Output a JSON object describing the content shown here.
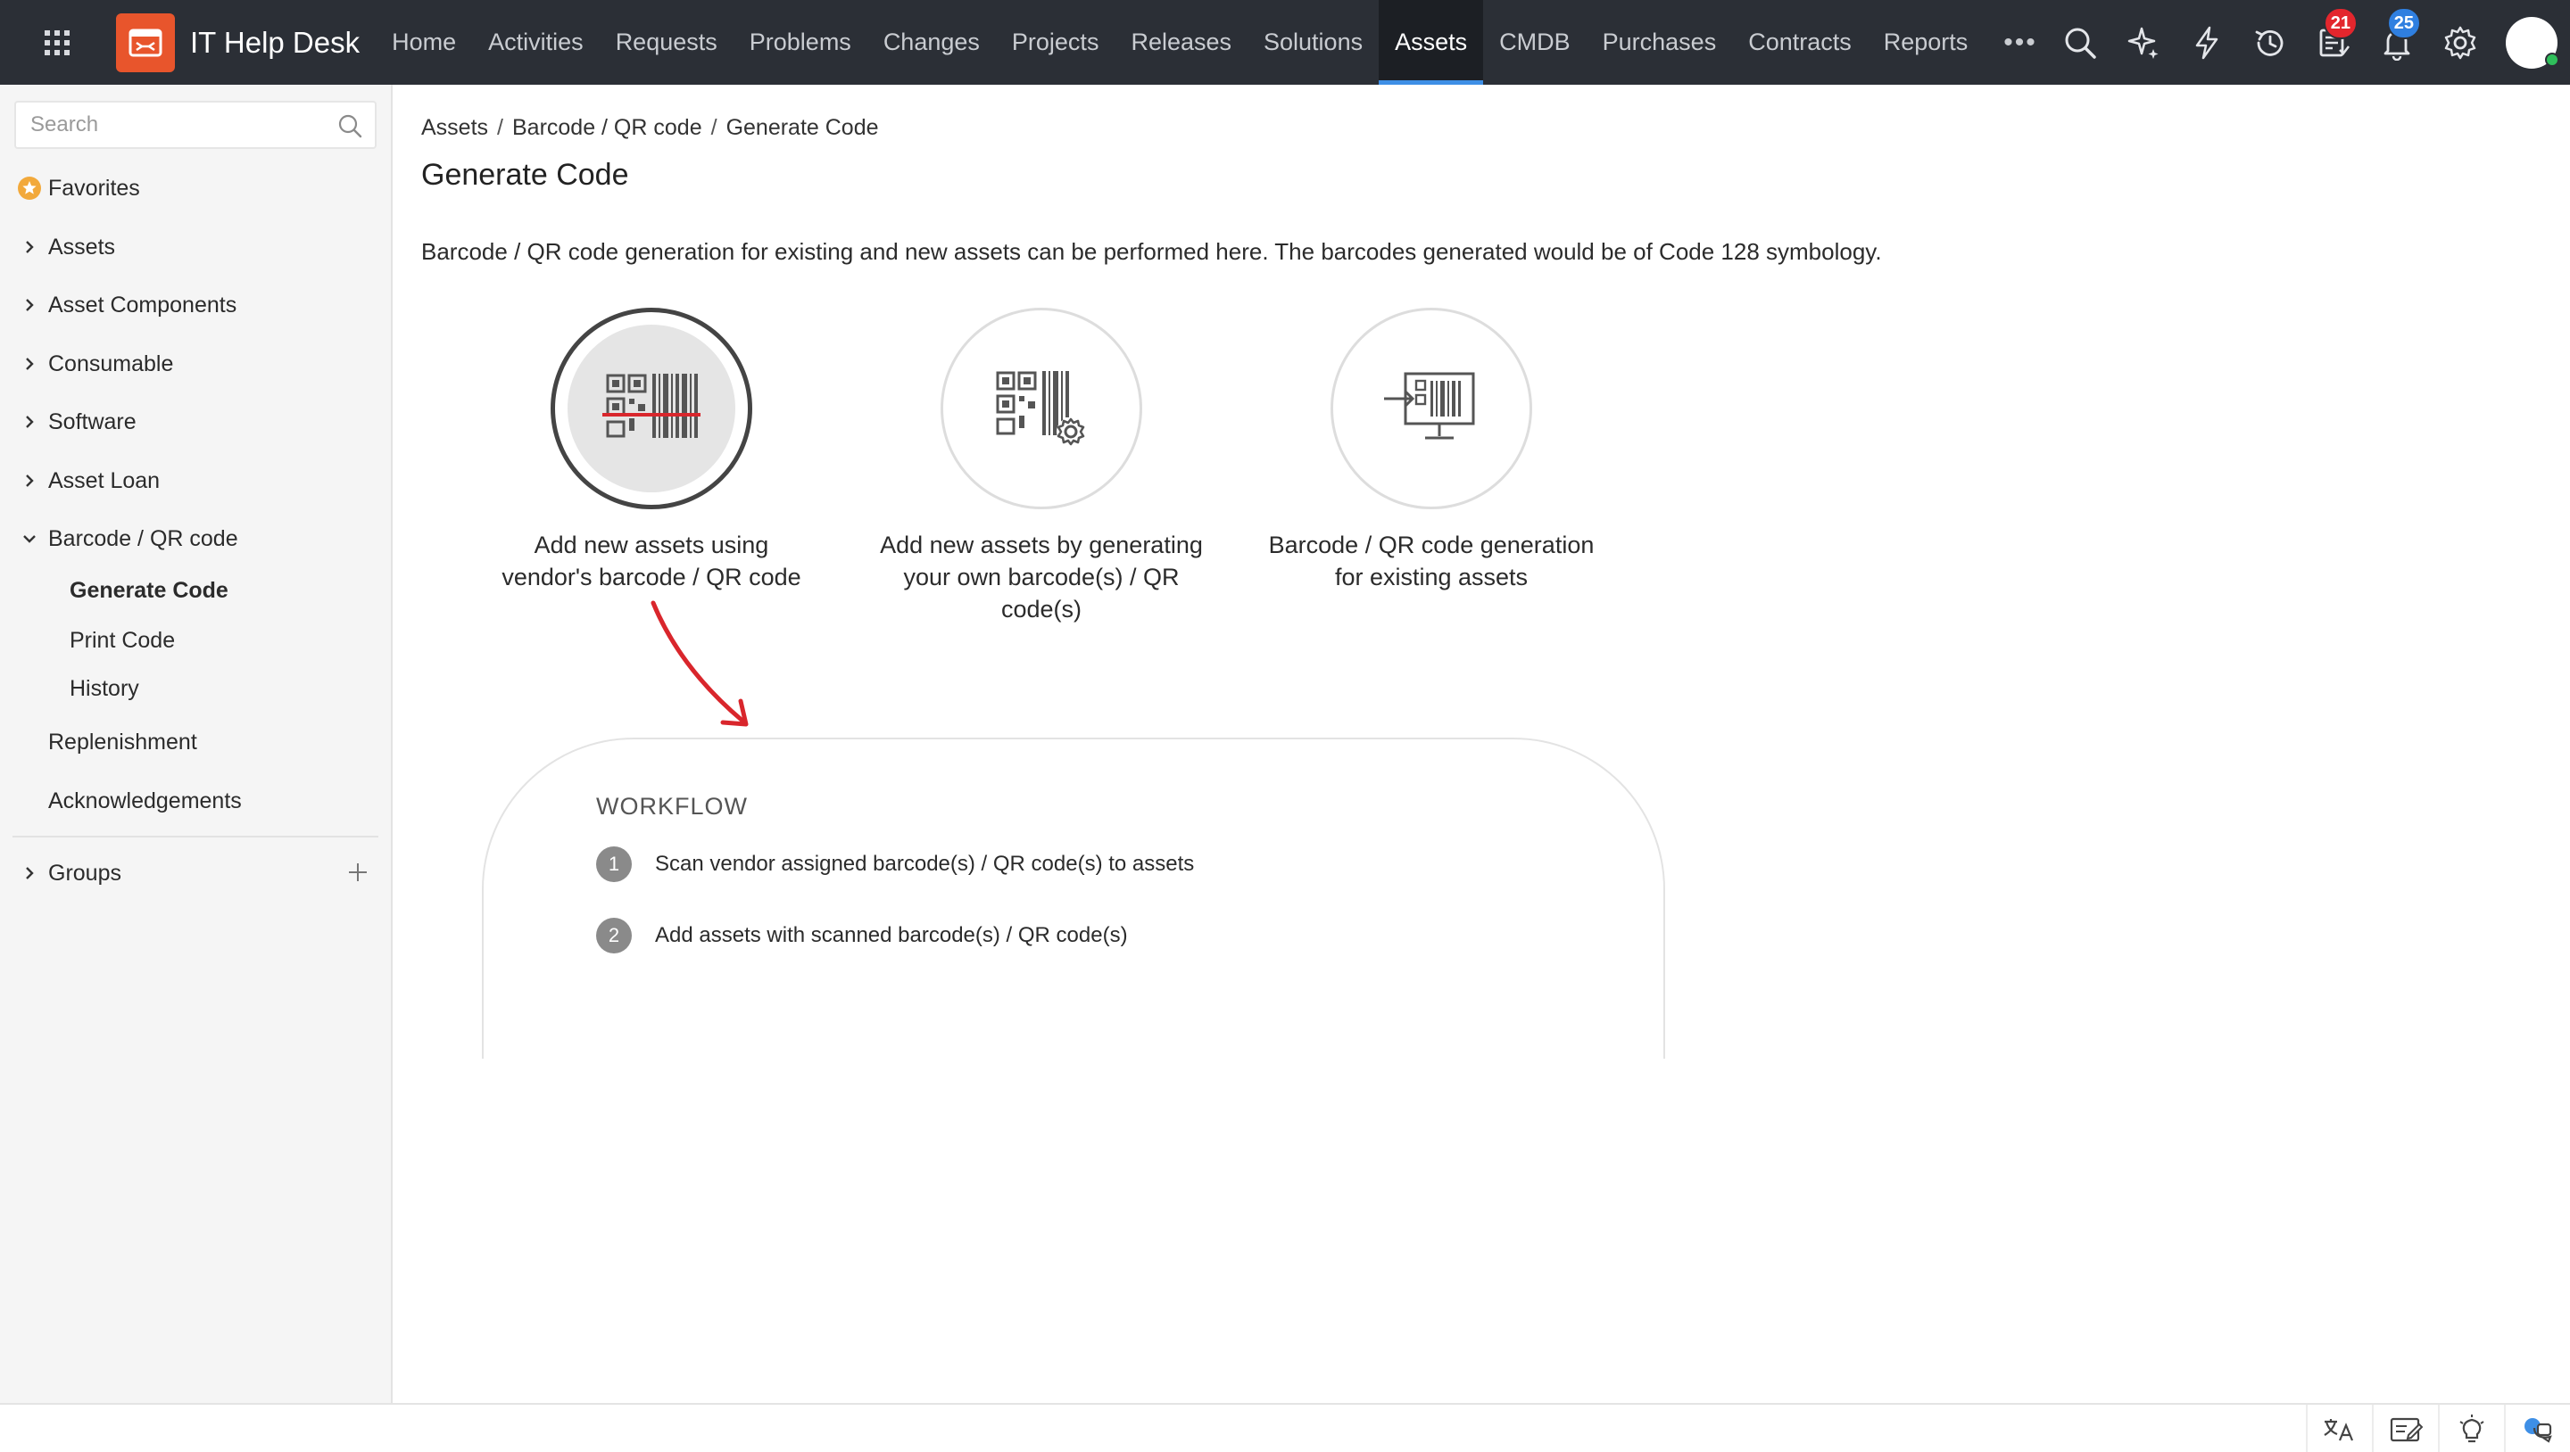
{
  "app": {
    "title": "IT Help Desk"
  },
  "colors": {
    "accent": "#3e8fe6",
    "brand": "#e8552c",
    "topbar": "#2b2f36",
    "badge_red": "#e3262d",
    "badge_blue": "#2f7fe0",
    "arrow": "#d9262c"
  },
  "nav": {
    "items": [
      {
        "label": "Home"
      },
      {
        "label": "Activities"
      },
      {
        "label": "Requests"
      },
      {
        "label": "Problems"
      },
      {
        "label": "Changes"
      },
      {
        "label": "Projects"
      },
      {
        "label": "Releases"
      },
      {
        "label": "Solutions"
      },
      {
        "label": "Assets",
        "active": true
      },
      {
        "label": "CMDB"
      },
      {
        "label": "Purchases"
      },
      {
        "label": "Contracts"
      },
      {
        "label": "Reports"
      }
    ],
    "more": "•••"
  },
  "toolbar": {
    "tasks_badge": "21",
    "notifications_badge": "25"
  },
  "sidebar": {
    "search_placeholder": "Search",
    "favorites": "Favorites",
    "items": {
      "assets": "Assets",
      "asset_components": "Asset Components",
      "consumable": "Consumable",
      "software": "Software",
      "asset_loan": "Asset Loan",
      "barcode": "Barcode / QR code",
      "generate_code": "Generate Code",
      "print_code": "Print Code",
      "history": "History",
      "replenishment": "Replenishment",
      "acknowledgements": "Acknowledgements",
      "groups": "Groups"
    }
  },
  "breadcrumb": {
    "b1": "Assets",
    "b2": "Barcode / QR code",
    "b3": "Generate Code",
    "sep": "/"
  },
  "page": {
    "title": "Generate Code",
    "intro": "Barcode / QR code generation for existing and new assets can be performed here. The barcodes generated would be of Code 128 symbology."
  },
  "options": {
    "o1": {
      "line1": "Add new assets using",
      "line2": "vendor's barcode / QR code",
      "line3": ""
    },
    "o2": {
      "line1": "Add new assets by generating",
      "line2": "your own barcode(s) / QR",
      "line3": "code(s)"
    },
    "o3": {
      "line1": "Barcode / QR code generation",
      "line2": "for existing assets",
      "line3": ""
    }
  },
  "workflow": {
    "title": "WORKFLOW",
    "steps": [
      {
        "num": "1",
        "text": "Scan vendor assigned barcode(s) / QR code(s) to assets"
      },
      {
        "num": "2",
        "text": "Add assets with scanned barcode(s) / QR code(s)"
      }
    ]
  }
}
